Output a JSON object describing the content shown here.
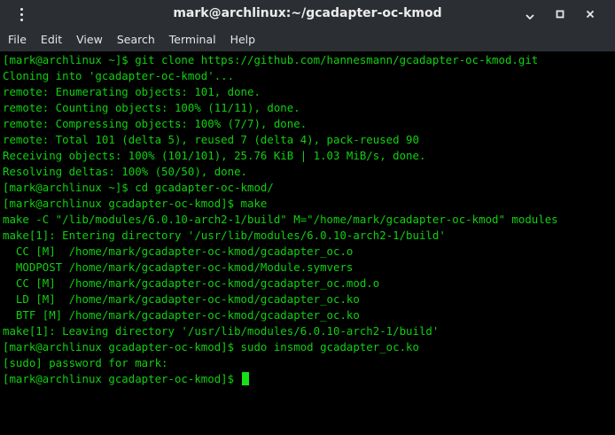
{
  "window": {
    "title": "mark@archlinux:~/gcadapter-oc-kmod",
    "menu_icon": "kebab-menu-icon",
    "minimize_icon": "minimize-icon",
    "maximize_icon": "maximize-icon",
    "close_icon": "close-icon"
  },
  "menubar": {
    "items": [
      "File",
      "Edit",
      "View",
      "Search",
      "Terminal",
      "Help"
    ]
  },
  "terminal": {
    "text_color": "#10d010",
    "background": "#000000",
    "lines": [
      "[mark@archlinux ~]$ git clone https://github.com/hannesmann/gcadapter-oc-kmod.git",
      "Cloning into 'gcadapter-oc-kmod'...",
      "remote: Enumerating objects: 101, done.",
      "remote: Counting objects: 100% (11/11), done.",
      "remote: Compressing objects: 100% (7/7), done.",
      "remote: Total 101 (delta 5), reused 7 (delta 4), pack-reused 90",
      "Receiving objects: 100% (101/101), 25.76 KiB | 1.03 MiB/s, done.",
      "Resolving deltas: 100% (50/50), done.",
      "[mark@archlinux ~]$ cd gcadapter-oc-kmod/",
      "[mark@archlinux gcadapter-oc-kmod]$ make",
      "make -C \"/lib/modules/6.0.10-arch2-1/build\" M=\"/home/mark/gcadapter-oc-kmod\" modules",
      "make[1]: Entering directory '/usr/lib/modules/6.0.10-arch2-1/build'",
      "  CC [M]  /home/mark/gcadapter-oc-kmod/gcadapter_oc.o",
      "  MODPOST /home/mark/gcadapter-oc-kmod/Module.symvers",
      "  CC [M]  /home/mark/gcadapter-oc-kmod/gcadapter_oc.mod.o",
      "  LD [M]  /home/mark/gcadapter-oc-kmod/gcadapter_oc.ko",
      "  BTF [M] /home/mark/gcadapter-oc-kmod/gcadapter_oc.ko",
      "make[1]: Leaving directory '/usr/lib/modules/6.0.10-arch2-1/build'",
      "[mark@archlinux gcadapter-oc-kmod]$ sudo insmod gcadapter_oc.ko",
      "[sudo] password for mark:"
    ],
    "prompt": "[mark@archlinux gcadapter-oc-kmod]$ "
  }
}
